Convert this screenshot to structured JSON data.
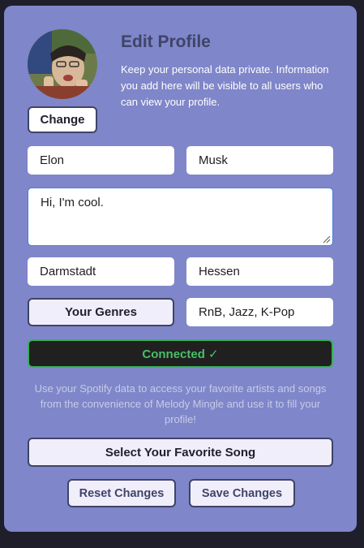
{
  "header": {
    "title": "Edit Profile",
    "description": "Keep your personal data private. Information you add here will be visible to all users who can view your profile."
  },
  "avatar": {
    "change_label": "Change"
  },
  "form": {
    "first_name": "Elon",
    "last_name": "Musk",
    "bio": "Hi, I'm cool.",
    "city": "Darmstadt",
    "state": "Hessen",
    "genres_button": "Your Genres",
    "genres_value": "RnB, Jazz, K-Pop"
  },
  "spotify": {
    "status": "Connected ✓",
    "note": "Use your Spotify data to access your favorite artists and songs from the convenience of Melody Mingle and use it to fill your profile!",
    "favorite_song_button": "Select Your Favorite Song"
  },
  "actions": {
    "reset": "Reset Changes",
    "save": "Save Changes"
  },
  "colors": {
    "card_bg": "#7f86c9",
    "accent_dark": "#3f4468",
    "connected_green": "#47c067"
  }
}
